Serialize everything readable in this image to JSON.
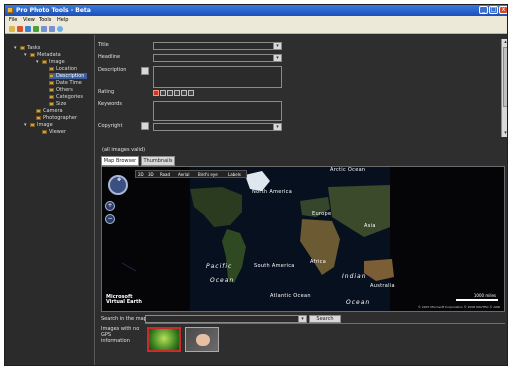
{
  "window": {
    "title": "Pro Photo Tools - Beta",
    "controls": [
      "_",
      "□",
      "x"
    ]
  },
  "menu": [
    "File",
    "View",
    "Tools",
    "Help"
  ],
  "toolbar_icons": [
    "open-icon",
    "save-icon",
    "import-icon",
    "export-icon",
    "undo-icon",
    "redo-icon",
    "help-icon"
  ],
  "tree": {
    "items": [
      {
        "label": "Tasks",
        "icon": "tasks-icon",
        "expander": "▾"
      },
      {
        "label": "Metadata",
        "icon": "metadata-icon",
        "expander": "▾"
      },
      {
        "label": "Image",
        "icon": "image-icon",
        "expander": "▾"
      },
      {
        "label": "Location",
        "icon": "location-icon",
        "expander": ""
      },
      {
        "label": "Description",
        "icon": "description-icon",
        "expander": "",
        "selected": true
      },
      {
        "label": "Date Time",
        "icon": "calendar-icon",
        "expander": ""
      },
      {
        "label": "Others",
        "icon": "others-icon",
        "expander": ""
      },
      {
        "label": "Categories",
        "icon": "categories-icon",
        "expander": ""
      },
      {
        "label": "Size",
        "icon": "size-icon",
        "expander": ""
      },
      {
        "label": "Camera",
        "icon": "camera-icon",
        "expander": ""
      },
      {
        "label": "Photographer",
        "icon": "photographer-icon",
        "expander": ""
      },
      {
        "label": "Image",
        "icon": "image-icon",
        "expander": "▾"
      },
      {
        "label": "Viewer",
        "icon": "viewer-icon",
        "expander": ""
      }
    ]
  },
  "form": {
    "title_label": "Title",
    "headline_label": "Headline",
    "description_label": "Description",
    "rating_label": "Rating",
    "keywords_label": "Keywords",
    "copyright_label": "Copyright",
    "rating_value": 0,
    "rating_max": 5
  },
  "group_label": "(all images valid)",
  "tabs": [
    {
      "label": "Map Browser",
      "active": true
    },
    {
      "label": "Thumbnails",
      "active": false
    }
  ],
  "map": {
    "nav_items": [
      "2D",
      "3D",
      "Road",
      "Aerial",
      "Bird's eye",
      "Labels"
    ],
    "labels": {
      "arctic": "Arctic Ocean",
      "north_america": "North America",
      "europe": "Europe",
      "asia": "Asia",
      "africa": "Africa",
      "south_america": "South America",
      "australia": "Australia",
      "pacific": "Pacific",
      "ocean_left": "Ocean",
      "indian": "Indian",
      "ocean_right": "Ocean",
      "atlantic": "Atlantic Ocean",
      "ocean_bottom": "Ocean"
    },
    "logo_line1": "Microsoft",
    "logo_line2": "Virtual Earth",
    "scale": "1000 miles",
    "copyright": "© 2007 Microsoft Corporation   © 2006 NAVTEQ   © AND"
  },
  "search": {
    "label": "Search in the map",
    "button": "Search"
  },
  "no_gps_label": "Images with no GPS information",
  "thumbnails": [
    {
      "name": "green-image",
      "selected": true
    },
    {
      "name": "dog-image",
      "selected": false
    }
  ],
  "colors": {
    "title_bar": "#1d4fb8",
    "selection": "#3f5f9c",
    "panel": "#2b2b2b",
    "accent_red": "#cc2a2a"
  }
}
